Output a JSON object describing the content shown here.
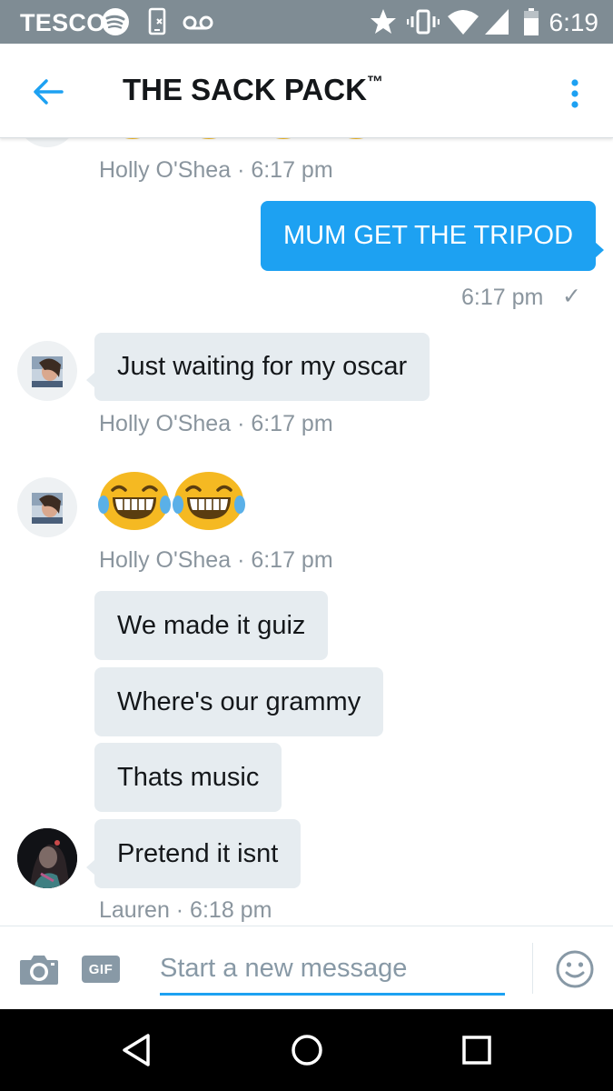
{
  "status_bar": {
    "carrier": "TESCO",
    "time": "6:19"
  },
  "header": {
    "title": "THE SACK PACK",
    "title_mark": "™"
  },
  "messages": {
    "m0_meta": "Holly O'Shea · 6:17 pm",
    "m1_text": "MUM GET THE TRIPOD",
    "m1_time": "6:17 pm",
    "m1_check": "✓",
    "m2_text": "Just waiting for my oscar",
    "m2_meta": "Holly O'Shea · 6:17 pm",
    "m3_meta": "Holly O'Shea · 6:17 pm",
    "m4_text": "We made it guiz",
    "m5_text": "Where's our grammy",
    "m6_text": "Thats music",
    "m7_text": "Pretend it isnt",
    "m7_meta": "Lauren · 6:18 pm"
  },
  "composer": {
    "placeholder": "Start a new message",
    "gif_label": "GIF"
  },
  "icons": {
    "status": [
      "spotify-icon",
      "phone-icon",
      "voicemail-icon",
      "star-icon",
      "vibrate-icon",
      "wifi-icon",
      "signal-icon",
      "battery-icon"
    ],
    "header": [
      "back-arrow-icon",
      "more-vertical-icon"
    ],
    "composer": [
      "camera-icon",
      "gif-icon",
      "emoji-smiley-icon"
    ],
    "nav": [
      "nav-back-icon",
      "nav-home-icon",
      "nav-recents-icon"
    ],
    "emoji": "face-with-tears-of-joy"
  },
  "colors": {
    "accent": "#1da1f2",
    "status_bar": "#7f8c94",
    "bubble_received": "#e6ecf0",
    "meta_text": "#8a959e"
  }
}
